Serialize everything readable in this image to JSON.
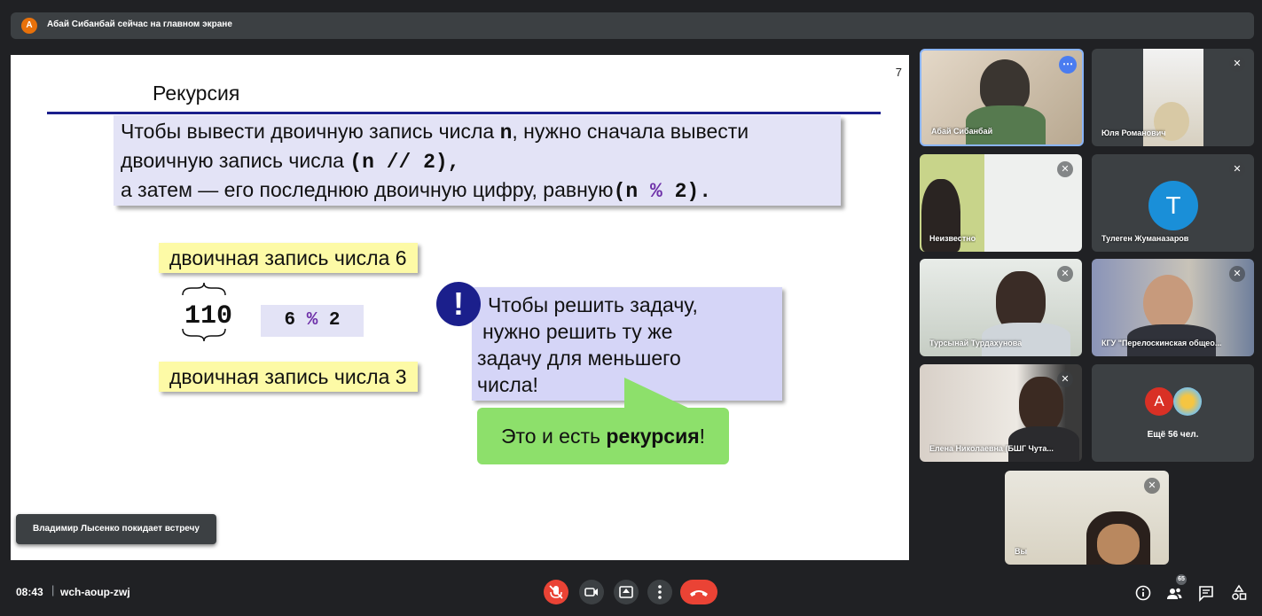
{
  "banner": {
    "avatar_letter": "А",
    "text": "Абай Сибанбай сейчас на главном экране"
  },
  "slide": {
    "page_number": "7",
    "title": "Рекурсия",
    "rule_line1_a": "Чтобы вывести двоичную запись числа ",
    "rule_line1_b": "n",
    "rule_line1_c": ", нужно сначала вывести",
    "rule_line2_a": "двоичную запись числа ",
    "rule_line2_b": "(n // 2)",
    "rule_line2_c": ",",
    "rule_line3_a": "а затем — его последнюю двоичную цифру, равную",
    "rule_line3_b": "(n ",
    "rule_line3_pct": "%",
    "rule_line3_c": " 2)",
    "rule_line3_d": ".",
    "label_top": "двоичная запись числа 6",
    "number": "110",
    "mod_a": "6 ",
    "mod_pct": "%",
    "mod_b": " 2",
    "label_bottom": "двоичная запись числа 3",
    "exclaim": "!",
    "callout_line1": "Чтобы решить задачу,",
    "callout_line2": " нужно решить ту же",
    "callout_line3": "задачу  для меньшего",
    "callout_line4": "числа!",
    "green_a": "Это и есть ",
    "green_b": "рекурсия",
    "green_c": "!"
  },
  "toast": "Владимир Лысенко покидает встречу",
  "participants": [
    {
      "name": "Абай Сибанбай"
    },
    {
      "name": "Юля Романович"
    },
    {
      "name": "Неизвестно"
    },
    {
      "name": "Тулеген Жуманазаров",
      "initial": "T"
    },
    {
      "name": "Турсынай Турдахунова"
    },
    {
      "name": "КГУ \"Перелоскинская общео..."
    },
    {
      "name": "Елена Николаевна (БШГ Чута..."
    },
    {
      "name": "Ещё 56 чел.",
      "initial": "А"
    },
    {
      "name": "Вы"
    }
  ],
  "footer": {
    "time": "08:43",
    "separator": "|",
    "meeting_code": "wch-aoup-zwj",
    "participant_count": "65"
  },
  "icons": [
    "mic-off-icon",
    "camera-icon",
    "present-icon",
    "more-icon",
    "hangup-icon",
    "info-icon",
    "people-icon",
    "chat-icon",
    "activities-icon"
  ],
  "colors": {
    "hangup": "#ea4335",
    "slide_rule": "#1b1f8c",
    "yellow_label": "#fdfaa6",
    "green_box": "#8de06b"
  }
}
